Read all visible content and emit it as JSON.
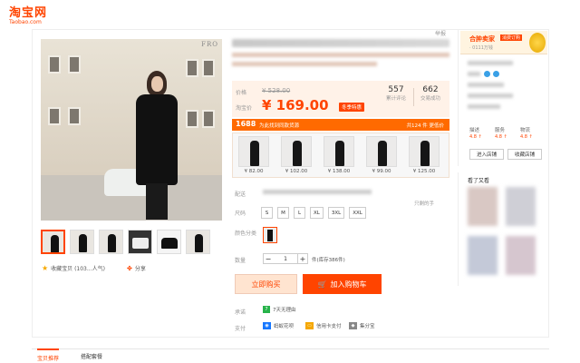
{
  "logo": {
    "cn": "淘宝网",
    "en": "Taobao.com"
  },
  "gallery": {
    "brand_mark": "FRO",
    "favorite_label": "收藏宝贝 (103...人气)",
    "share_label": "分享"
  },
  "header": {
    "report": "举报"
  },
  "price": {
    "original_label": "价格",
    "original": "¥ 528.00",
    "sale_label": "淘宝价",
    "sale": "¥ 169.00",
    "promo_tag": "冬季特惠",
    "reviews_count": "557",
    "reviews_label": "累计评论",
    "sales_count": "662",
    "sales_label": "交易成功"
  },
  "supply": {
    "logo": "1688",
    "text": "为此找到同款货源",
    "right": "共124 件 更低价",
    "prices": [
      "¥ 82.00",
      "¥ 102.00",
      "¥ 138.00",
      "¥ 99.00",
      "¥ 125.00"
    ]
  },
  "options": {
    "delivery_label": "配送",
    "only_hint": "只剩的手",
    "size_label": "尺码",
    "sizes": [
      "S",
      "M",
      "L",
      "XL",
      "3XL",
      "XXL"
    ],
    "color_label": "颜色分类",
    "qty_label": "数量",
    "qty_value": "1",
    "stock": "件(库存386件)",
    "minus": "−",
    "plus": "+"
  },
  "actions": {
    "buy_now": "立即购买",
    "add_cart": "加入购物车"
  },
  "services": {
    "promise_label": "承诺",
    "promise_item": "7天无理由",
    "pay_label": "支付",
    "pay_items": [
      "蚂蚁花呗",
      "信用卡支付",
      "集分宝"
    ]
  },
  "seller": {
    "banner_title": "合肿卖家",
    "banner_badge": "消费订购",
    "banner_sub": "· 0111万钱",
    "scores": [
      {
        "label": "描述",
        "value": "4.8 ↑"
      },
      {
        "label": "服务",
        "value": "4.8 ↑"
      },
      {
        "label": "物流",
        "value": "4.8 ↑"
      }
    ],
    "enter_shop": "进入店铺",
    "favorite_shop": "收藏店铺"
  },
  "recommendations": {
    "title": "看了又看"
  },
  "tabs": [
    "宝贝推荐",
    "搭配套餐"
  ],
  "colors": {
    "accent": "#ff4400",
    "banner": "#ff6a00",
    "price_bg": "#fff2e8"
  }
}
